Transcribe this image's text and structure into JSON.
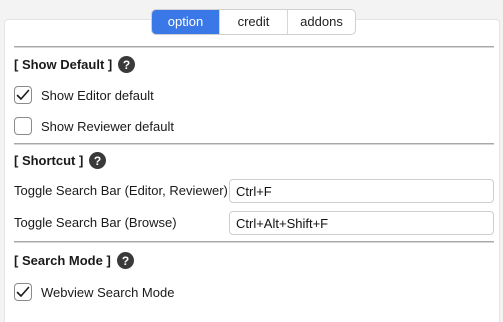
{
  "tabs": {
    "option": "option",
    "credit": "credit",
    "addons": "addons"
  },
  "show_default": {
    "title": "[ Show Default ]",
    "editor_label": "Show Editor default",
    "editor_checked": true,
    "reviewer_label": "Show Reviewer default",
    "reviewer_checked": false
  },
  "shortcut": {
    "title": "[ Shortcut ]",
    "editor_reviewer_label": "Toggle Search Bar (Editor, Reviewer)",
    "editor_reviewer_value": "Ctrl+F",
    "browse_label": "Toggle Search Bar (Browse)",
    "browse_value": "Ctrl+Alt+Shift+F"
  },
  "search_mode": {
    "title": "[ Search Mode ]",
    "webview_label": "Webview Search Mode",
    "webview_checked": true
  },
  "colors": {
    "accent": "#3b78e7",
    "help_icon": "#3a3a3a"
  }
}
